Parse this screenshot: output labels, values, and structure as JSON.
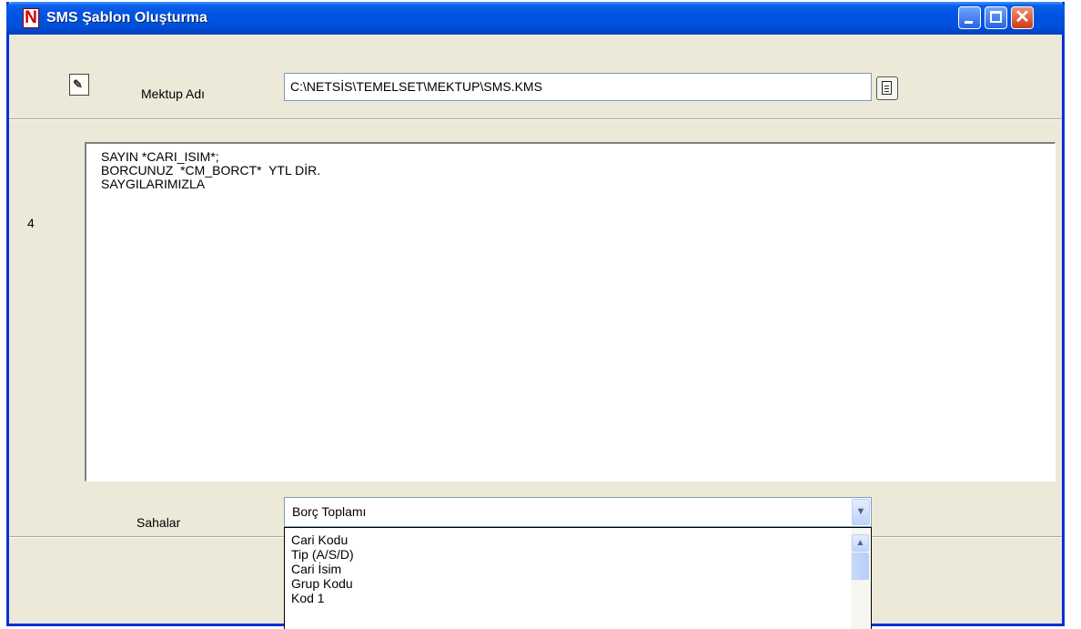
{
  "window": {
    "title": "SMS Şablon Oluşturma",
    "app_icon_letter": "N",
    "close_glyph": "✕"
  },
  "header": {
    "doc_icon_glyph": "✎",
    "mektup_label": "Mektup Adı",
    "mektup_path": "C:\\NETSİS\\TEMELSET\\MEKTUP\\SMS.KMS"
  },
  "editor": {
    "line_indicator": "4",
    "lines": [
      "SAYIN *CARI_ISIM*;",
      "BORCUNUZ  *CM_BORCT*  YTL DİR.",
      "SAYGILARIMIZLA"
    ]
  },
  "fields": {
    "label": "Sahalar",
    "selected": "Borç Toplamı",
    "options": [
      "Cari Kodu",
      "Tip (A/S/D)",
      "Cari İsim",
      "Grup Kodu",
      "Kod 1"
    ]
  },
  "icons": {
    "minimize": "minimize-icon",
    "maximize": "maximize-icon",
    "close": "close-icon",
    "dropdown": "chevron-down-icon",
    "scroll_up": "chevron-up-icon"
  }
}
